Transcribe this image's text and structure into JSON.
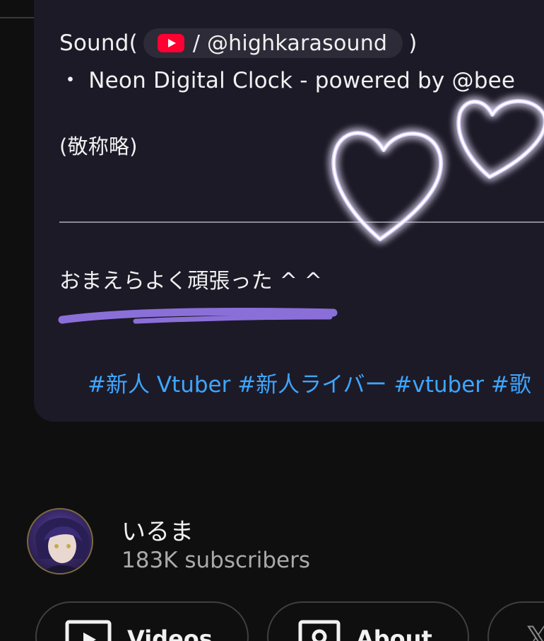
{
  "description": {
    "sound_prefix": "Sound(",
    "sound_chip_label": "/ @highkarasound",
    "sound_suffix": ")",
    "clock_line": "・ Neon Digital Clock - powered by @bee",
    "credit_note": "(敬称略)",
    "closing_message": "おまえらよく頑張った ^ ^",
    "hashtags": "#新人 Vtuber #新人ライバー #vtuber #歌"
  },
  "channel": {
    "name": "いるま",
    "subscribers": "183K subscribers"
  },
  "tabs": [
    {
      "label": "Videos",
      "icon": "play-box-icon"
    },
    {
      "label": "About",
      "icon": "portrait-box-icon"
    },
    {
      "label": "",
      "icon": "x-logo-icon"
    }
  ],
  "colors": {
    "card_bg": "#1c1a27",
    "link": "#3ea6ff",
    "marker_stroke": "#8b6fd8",
    "heart_glow": "#c9b8ff",
    "youtube_red": "#ff0033"
  }
}
